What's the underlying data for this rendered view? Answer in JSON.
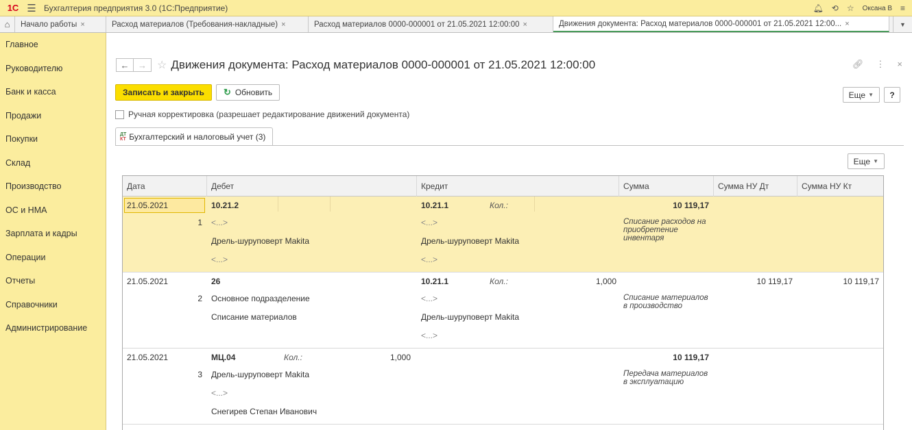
{
  "app": {
    "title": "Бухгалтерия предприятия 3.0  (1С:Предприятие)",
    "user": "Оксана В"
  },
  "tabs": [
    {
      "label": "Начало работы"
    },
    {
      "label": "Расход материалов (Требования-накладные)"
    },
    {
      "label": "Расход материалов 0000-000001 от 21.05.2021 12:00:00"
    },
    {
      "label": "Движения документа: Расход материалов 0000-000001 от 21.05.2021 12:00..."
    }
  ],
  "sidebar": [
    "Главное",
    "Руководителю",
    "Банк и касса",
    "Продажи",
    "Покупки",
    "Склад",
    "Производство",
    "ОС и НМА",
    "Зарплата и кадры",
    "Операции",
    "Отчеты",
    "Справочники",
    "Администрирование"
  ],
  "form": {
    "title": "Движения документа: Расход материалов 0000-000001 от 21.05.2021 12:00:00",
    "save_close": "Записать и закрыть",
    "refresh": "Обновить",
    "more": "Еще",
    "help": "?",
    "manual_edit": "Ручная корректировка (разрешает редактирование движений документа)",
    "subtab": "Бухгалтерский и налоговый учет (3)",
    "subtab_icon_dt": "ДТ",
    "subtab_icon_kt": "КТ",
    "grid_more": "Еще"
  },
  "columns": [
    "Дата",
    "Дебет",
    "Кредит",
    "Сумма",
    "Сумма НУ Дт",
    "Сумма НУ Кт"
  ],
  "records": [
    {
      "date": "21.05.2021",
      "num": "1",
      "debit": [
        "10.21.2",
        "<...>",
        "Дрель-шуруповерт Makita",
        "<...>"
      ],
      "debit_qty_label": "",
      "debit_qty": "",
      "credit": [
        "10.21.1",
        "<...>",
        "Дрель-шуруповерт Makita",
        "<...>"
      ],
      "credit_qty_label": "Кол.:",
      "credit_qty": "",
      "sum": "10 119,17",
      "desc": "Списание расходов на приобретение инвентаря",
      "nu_dt": "",
      "nu_kt": ""
    },
    {
      "date": "21.05.2021",
      "num": "2",
      "debit": [
        "26",
        "Основное подразделение",
        "Списание материалов",
        ""
      ],
      "debit_qty_label": "",
      "debit_qty": "",
      "credit": [
        "10.21.1",
        "<...>",
        "Дрель-шуруповерт Makita",
        "<...>"
      ],
      "credit_qty_label": "Кол.:",
      "credit_qty": "1,000",
      "sum": "",
      "desc": "Списание материалов в производство",
      "nu_dt": "10 119,17",
      "nu_kt": "10 119,17"
    },
    {
      "date": "21.05.2021",
      "num": "3",
      "debit": [
        "МЦ.04",
        "Дрель-шуруповерт Makita",
        "<...>",
        "Снегирев Степан Иванович"
      ],
      "debit_qty_label": "Кол.:",
      "debit_qty": "1,000",
      "credit": [
        "",
        "",
        "",
        ""
      ],
      "credit_qty_label": "",
      "credit_qty": "",
      "sum": "10 119,17",
      "desc": "Передача материалов в эксплуатацию",
      "nu_dt": "",
      "nu_kt": ""
    }
  ]
}
